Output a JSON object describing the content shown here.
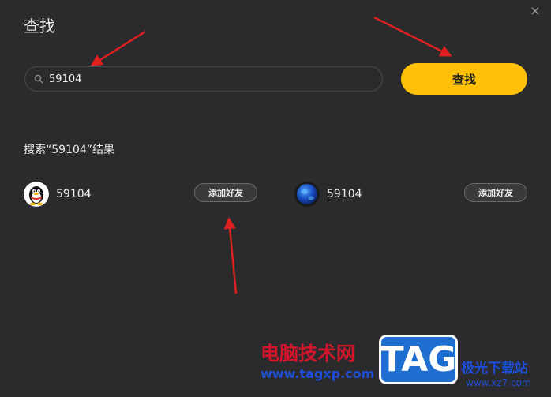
{
  "dialog": {
    "title": "查找",
    "close_glyph": "×"
  },
  "search": {
    "value": "59104",
    "placeholder": "",
    "icon": "search-icon",
    "button_label": "查找"
  },
  "results": {
    "label": "搜索“59104”结果",
    "items": [
      {
        "name": "59104",
        "avatar": "penguin-avatar",
        "action_label": "添加好友"
      },
      {
        "name": "59104",
        "avatar": "globe-avatar",
        "action_label": "添加好友"
      }
    ]
  },
  "watermark": {
    "cn_text": "电脑技术网",
    "url": "www.tagxp.com",
    "tag": "TAG",
    "site": "极光下载站",
    "site_url": "www.xz7.com"
  },
  "colors": {
    "background": "#2b2b2d",
    "accent": "#ffc107",
    "annotation_arrow": "#e02020"
  }
}
